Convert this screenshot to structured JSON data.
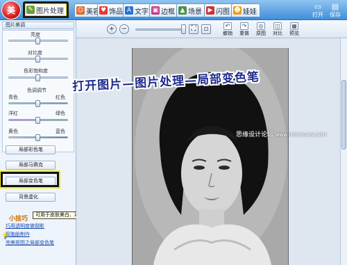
{
  "app": {
    "logo_text": "美"
  },
  "tabs": [
    {
      "label": "图片处理",
      "icon": "edit-image-icon",
      "active": true
    },
    {
      "label": "美容",
      "icon": "beauty-icon"
    },
    {
      "label": "饰品",
      "icon": "heart-icon"
    },
    {
      "label": "文字",
      "icon": "text-icon"
    },
    {
      "label": "边框",
      "icon": "frame-icon"
    },
    {
      "label": "场景",
      "icon": "scene-icon"
    },
    {
      "label": "闪图",
      "icon": "flash-icon"
    },
    {
      "label": "娃娃",
      "icon": "doll-icon"
    }
  ],
  "top_actions": {
    "open_label": "打开",
    "save_label": "保存"
  },
  "left_panel": {
    "title": "图片美调",
    "brightness": "亮度",
    "contrast": "对比度",
    "saturation": "色彩饱和度",
    "color_adjust": "色调调节",
    "cyan": "青色",
    "red": "红色",
    "magenta": "洋红",
    "green": "绿色",
    "yellow": "黄色",
    "blue": "蓝色",
    "tools": [
      "局部彩色笔",
      "局部马赛克",
      "局部变色笔",
      "背景虚化"
    ],
    "tooltip": "可用于皮肤美白、染发、唇彩哦。",
    "tips_title": "小技巧",
    "tips": [
      "巧用透明度做倒影",
      "双胞胎制作",
      "完美抠图之局部变色笔"
    ]
  },
  "toolbar": {
    "zoom_in": "+",
    "zoom_out": "−",
    "buttons": [
      "撤销",
      "重做",
      "原图",
      "对比",
      "预览"
    ]
  },
  "overlay": {
    "headline": "打开图片—图片处理—局部变色笔",
    "watermark_cn": "思缘设计论坛",
    "watermark_en": "www.MISSYUAN.COM"
  }
}
